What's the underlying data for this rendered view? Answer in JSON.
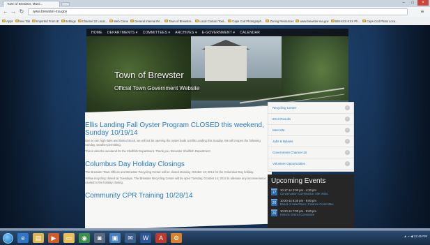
{
  "browser": {
    "tab_title": "Town of Brewster, Mass...",
    "url": "www.brewster-ma.gov",
    "bookmarks": [
      "Apps",
      "Neo Tab",
      "Imported From IE",
      "Settings",
      "Channel 22 Locat...",
      "Web Crime",
      "General Internal Re...",
      "Town of Brewster...",
      "Local Contact Tool...",
      "Cape Cod Photograph...",
      "Zoning Resources",
      "www.brewster-ma.gov",
      "508-XXX-XXX Ph...",
      "Cape Cod Photo Loca..."
    ]
  },
  "site": {
    "nav": [
      "HOME",
      "DEPARTMENTS ▾",
      "COMMITTEES ▾",
      "ARCHIVES ▾",
      "E-GOVERNMENT ▾",
      "CALENDAR"
    ],
    "title": "Town of Brewster",
    "subtitle": "Official Town Government Website",
    "articles": [
      {
        "title": "Ellis Landing Fall Oyster Program CLOSED this weekend, Sunday 10/19/14",
        "body": [
          "Due to rain high tides and limited stock, we will not be opening the oyster beds at Ellis Landing this Sunday. We will reopen the following Sunday, weather permitting.",
          "This is also the weekend for the Shellfish Department. Thank you, Brewster Shellfish Department"
        ]
      },
      {
        "title": "Columbus Day Holiday Closings",
        "body": [
          "The Brewster Town Offices and Brewster Recycling Center will be closed Monday, October 13, 2014 for the Columbus Day holiday.",
          "Yellow recycling closed on Tuesdays. The Brewster Recycling Center will be open Tuesday, October 14, 2014 to alleviate any inconvenience caused to the holiday closing."
        ]
      },
      {
        "title": "Community CPR Training 10/28/14",
        "body": []
      }
    ],
    "sidebar_links": [
      "Recycling Center",
      "2013 Results",
      "Meet Me",
      "Jobs & Bylaws",
      "Government Channel 18",
      "Volunteer Opportunities"
    ],
    "events_title": "Upcoming Events",
    "events": [
      {
        "day": "17",
        "when": "10-17-14 2:00 pm - 4:30 pm",
        "what": "Conservation Commission Site Visits"
      },
      {
        "day": "20",
        "when": "10-20-14 6:30 pm - 9:00 pm",
        "what": "Board of Selectmen / Finance Committee"
      },
      {
        "day": "20",
        "when": "10-20-14 7:00 pm - 9:00 pm",
        "what": "Historic District Committee"
      }
    ]
  },
  "taskbar": {
    "apps": [
      "ie",
      "explorer",
      "media",
      "folder",
      "chrome",
      "cam",
      "doc",
      "mail",
      "word",
      "acrobat",
      "tools"
    ],
    "tray_text": "▲ ⌁ ◀ 12:45 PM"
  },
  "colors": {
    "link_blue": "#2a7cc0",
    "dark_panel": "#262626",
    "nav_bg": "#0f0f0f"
  }
}
